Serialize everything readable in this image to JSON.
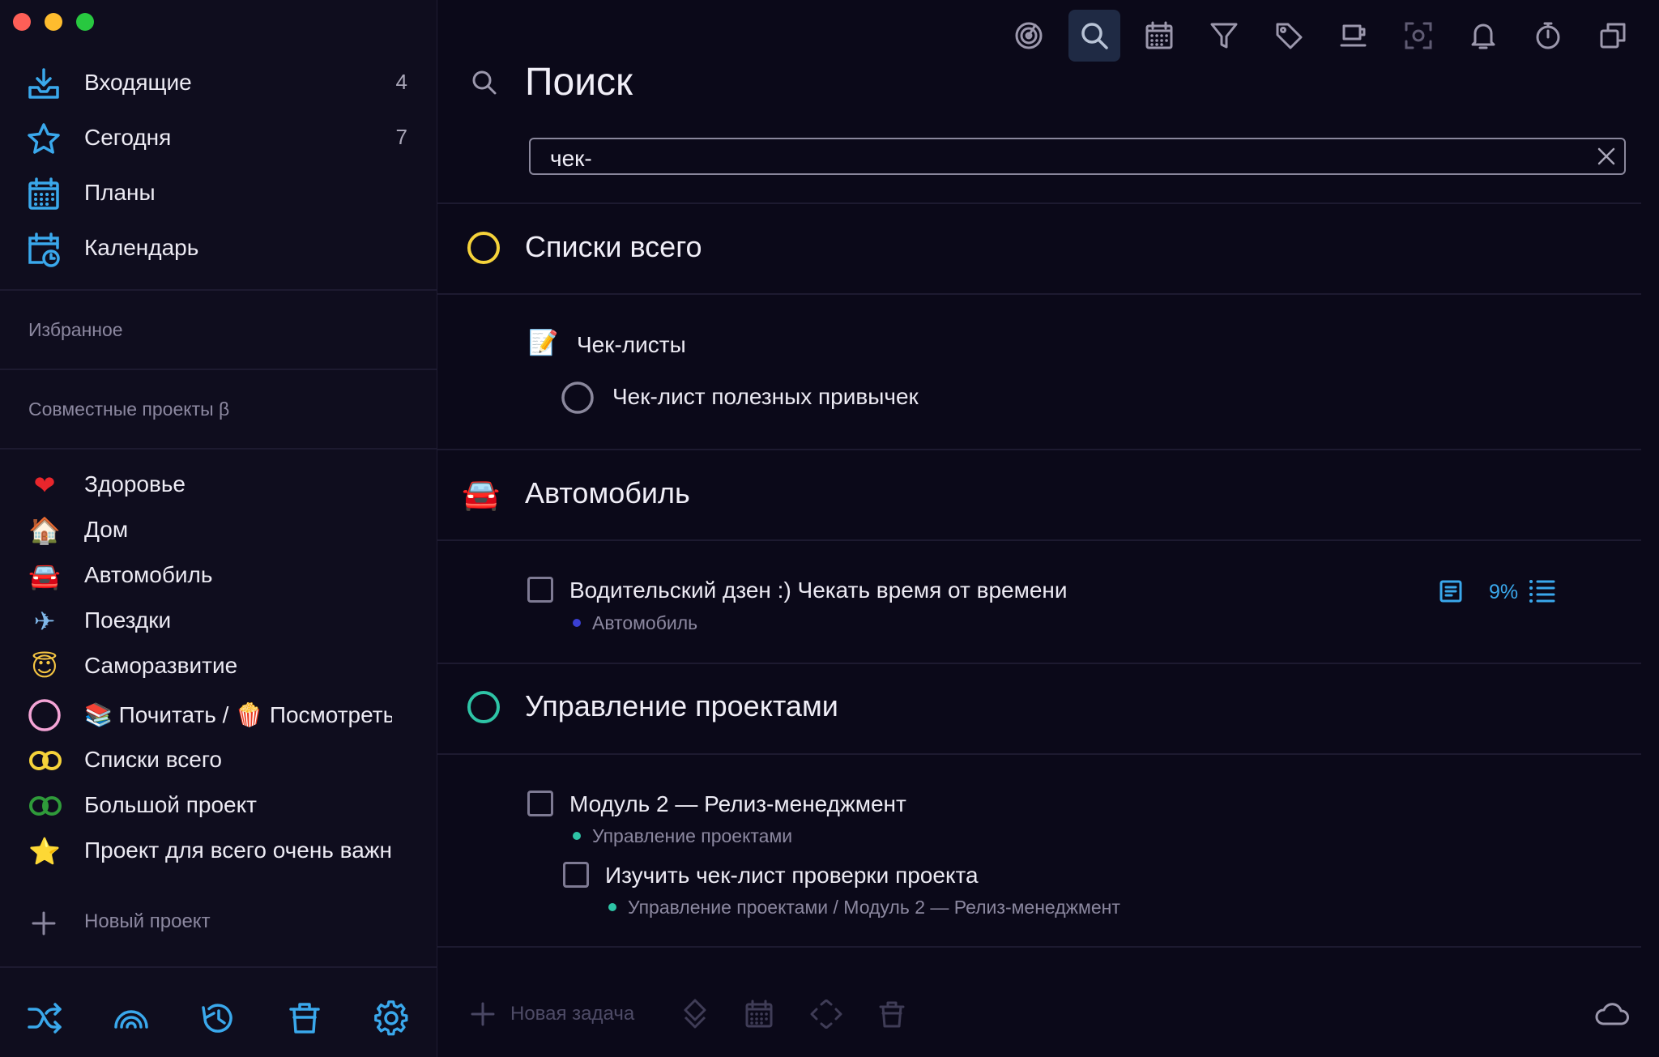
{
  "colors": {
    "accent": "#3aa8ec",
    "yellow": "#f5d23a",
    "green": "#2ec4a6",
    "darkgreen": "#2f9a3a",
    "pink": "#f4a4d6",
    "blue_dot": "#3a3fd2"
  },
  "sidebar": {
    "nav": [
      {
        "label": "Входящие",
        "count": "4",
        "icon": "inbox-icon"
      },
      {
        "label": "Сегодня",
        "count": "7",
        "icon": "star-icon"
      },
      {
        "label": "Планы",
        "count": "",
        "icon": "calendar-grid-icon"
      },
      {
        "label": "Календарь",
        "count": "",
        "icon": "calendar-clock-icon"
      }
    ],
    "favorites_label": "Избранное",
    "shared_label": "Совместные проекты β",
    "projects": [
      {
        "emoji": "❤",
        "label": "Здоровье"
      },
      {
        "emoji": "🏠",
        "label": "Дом"
      },
      {
        "emoji": "🚘",
        "label": "Автомобиль"
      },
      {
        "emoji": "✈",
        "label": "Поездки"
      },
      {
        "emoji": "😇",
        "label": "Саморазвитие"
      },
      {
        "emoji": "",
        "label": "📚 Почитать / 🍿 Посмотреть"
      },
      {
        "emoji": "",
        "label": "Списки всего"
      },
      {
        "emoji": "",
        "label": "Большой проект"
      },
      {
        "emoji": "⭐",
        "label": "Проект для всего очень важного"
      }
    ],
    "new_project_label": "Новый проект"
  },
  "search": {
    "title": "Поиск",
    "query": "чек-"
  },
  "groups": [
    {
      "title": "Списки всего",
      "heading": {
        "emoji": "📝",
        "label": "Чек-листы"
      },
      "items": [
        {
          "title": "Чек-лист полезных привычек"
        }
      ]
    },
    {
      "title": "Автомобиль",
      "items": [
        {
          "title": "Водительский дзен :) Чекать время от времени",
          "path": "Автомобиль",
          "progress": "9%"
        }
      ]
    },
    {
      "title": "Управление проектами",
      "items": [
        {
          "title": "Модуль 2 — Релиз-менеджмент",
          "path": "Управление проектами"
        },
        {
          "title": "Изучить чек-лист проверки проекта",
          "path": "Управление проектами / Модуль 2 — Релиз-менеджмент"
        }
      ]
    }
  ],
  "footer": {
    "new_task_label": "Новая задача"
  }
}
